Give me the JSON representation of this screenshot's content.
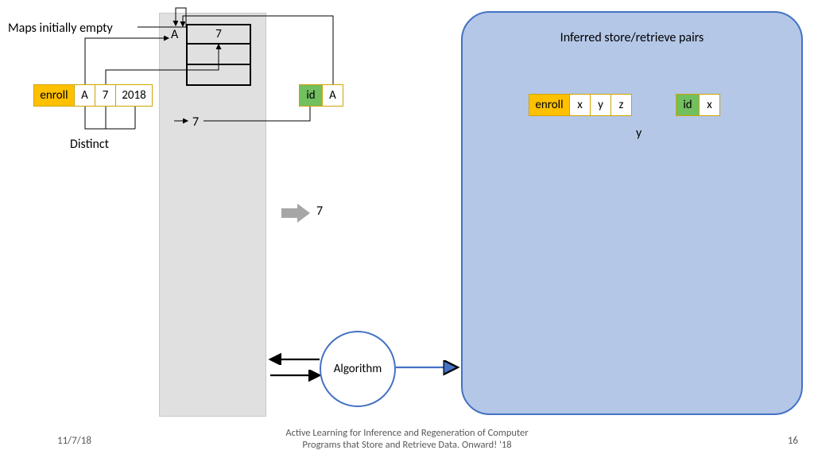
{
  "maps_empty": "Maps initially empty",
  "distinct": "Distinct",
  "gray": {
    "a_label": "A",
    "map_top": "7",
    "seven_out": "7"
  },
  "enroll": {
    "label": "enroll",
    "a": "A",
    "seven": "7",
    "year": "2018"
  },
  "id": {
    "label": "id",
    "a": "A"
  },
  "big_seven": "7",
  "algorithm": "Algorithm",
  "panel": {
    "title": "Inferred store/retrieve pairs",
    "enroll": {
      "label": "enroll",
      "x": "x",
      "y": "y",
      "z": "z"
    },
    "id": {
      "label": "id",
      "x": "x"
    },
    "y_out": "y"
  },
  "footer": {
    "date": "11/7/18",
    "title1": "Active Learning for Inference and Regeneration of Computer",
    "title2": "Programs that Store and Retrieve Data. Onward! '18",
    "page": "16"
  }
}
